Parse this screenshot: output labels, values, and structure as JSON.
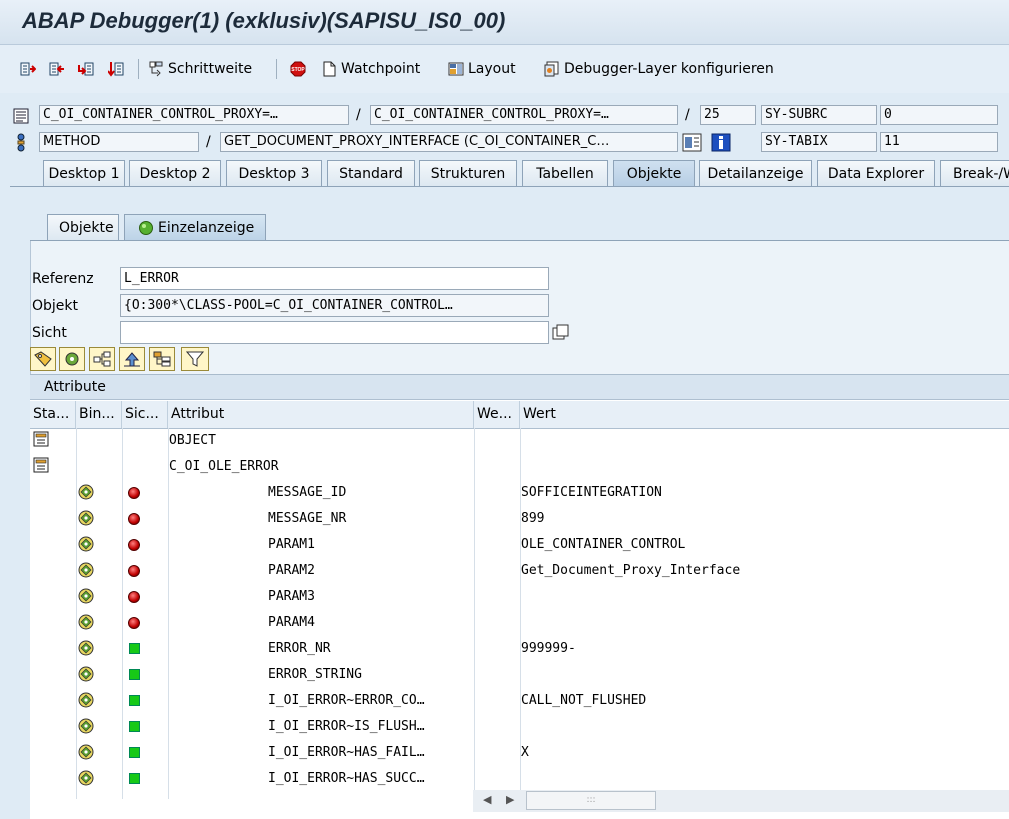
{
  "window": {
    "title": "ABAP Debugger(1)  (exklusiv)(SAPISU_IS0_00)"
  },
  "toolbar": {
    "schrittweite": "Schrittweite",
    "watchpoint": "Watchpoint",
    "layout": "Layout",
    "layer": "Debugger-Layer  konfigurieren"
  },
  "header": {
    "row1": {
      "field1": "C_OI_CONTAINER_CONTROL_PROXY=…",
      "field2": "C_OI_CONTAINER_CONTROL_PROXY=…",
      "line": "25",
      "var": "SY-SUBRC",
      "value": "0"
    },
    "row2": {
      "field1": "METHOD",
      "field2": "GET_DOCUMENT_PROXY_INTERFACE (C_OI_CONTAINER_C…",
      "var": "SY-TABIX",
      "value": "11"
    }
  },
  "tabs": [
    "Desktop 1",
    "Desktop 2",
    "Desktop 3",
    "Standard",
    "Strukturen",
    "Tabellen",
    "Objekte",
    "Detailanzeige",
    "Data Explorer",
    "Break-/W"
  ],
  "subtabs": {
    "objekte": "Objekte",
    "einzel": "Einzelanzeige"
  },
  "form": {
    "referenz_label": "Referenz",
    "referenz_value": "L_ERROR",
    "objekt_label": "Objekt",
    "objekt_value": "{O:300*\\CLASS-POOL=C_OI_CONTAINER_CONTROL…",
    "sicht_label": "Sicht",
    "sicht_value": ""
  },
  "table": {
    "title": "Attribute",
    "columns": [
      "Sta...",
      "Bin...",
      "Sic...",
      "Attribut",
      "We...",
      "Wert"
    ],
    "rows": [
      {
        "attr": "OBJECT",
        "value": ""
      },
      {
        "attr": "C_OI_OLE_ERROR",
        "value": ""
      },
      {
        "attr": "MESSAGE_ID",
        "value": "SOFFICEINTEGRATION"
      },
      {
        "attr": "MESSAGE_NR",
        "value": "899"
      },
      {
        "attr": "PARAM1",
        "value": "OLE_CONTAINER_CONTROL"
      },
      {
        "attr": "PARAM2",
        "value": "Get_Document_Proxy_Interface"
      },
      {
        "attr": "PARAM3",
        "value": ""
      },
      {
        "attr": "PARAM4",
        "value": ""
      },
      {
        "attr": "ERROR_NR",
        "value": "999999-"
      },
      {
        "attr": "ERROR_STRING",
        "value": ""
      },
      {
        "attr": "I_OI_ERROR~ERROR_CO…",
        "value": "CALL_NOT_FLUSHED"
      },
      {
        "attr": "I_OI_ERROR~IS_FLUSH…",
        "value": ""
      },
      {
        "attr": "I_OI_ERROR~HAS_FAIL…",
        "value": "X"
      },
      {
        "attr": "I_OI_ERROR~HAS_SUCC…",
        "value": ""
      }
    ]
  },
  "scroll": {
    "grip": ":::"
  }
}
